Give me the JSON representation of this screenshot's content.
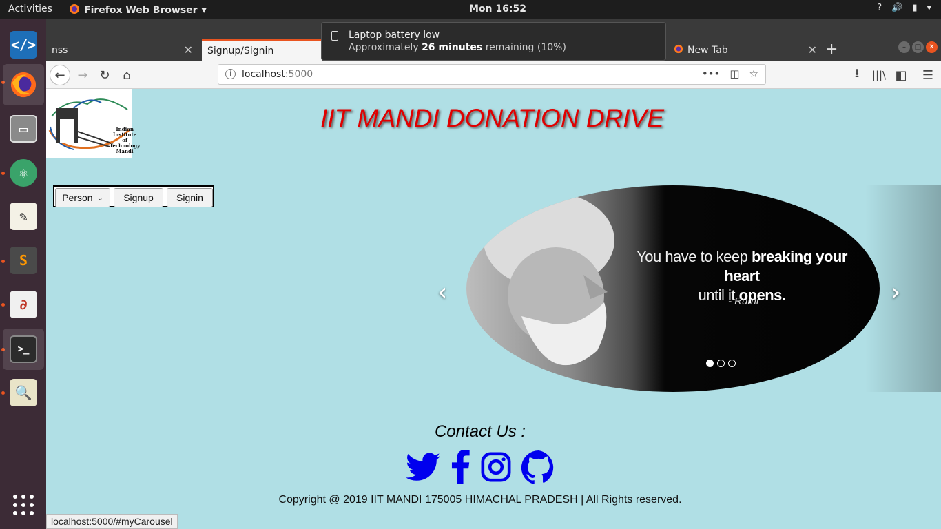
{
  "topbar": {
    "activities": "Activities",
    "app_name": "Firefox Web Browser",
    "clock": "Mon 16:52"
  },
  "browser": {
    "tabs": [
      {
        "title": "nss"
      },
      {
        "title": "Signup/Signin"
      },
      {
        "title": "New Tab"
      }
    ],
    "url_host": "localhost",
    "url_port": ":5000",
    "status_url": "localhost:5000/#myCarousel"
  },
  "notification": {
    "title": "Laptop battery low",
    "body_prefix": "Approximately",
    "body_bold": "26 minutes",
    "body_suffix": "remaining (10%)"
  },
  "page": {
    "logo_text_1": "Indian",
    "logo_text_2": "Institute of",
    "logo_text_3": "Technology",
    "logo_text_4": "Mandi",
    "title": "IIT MANDI DONATION DRIVE",
    "auth": {
      "select_value": "Person",
      "signup_label": "Signup",
      "signin_label": "Signin"
    },
    "carousel": {
      "quote_1": "You have to keep",
      "quote_bold": "breaking your heart",
      "quote_2": "until it",
      "quote_bold_2": "opens.",
      "author": "- Rumi",
      "slide_count": 3,
      "active_index": 0
    },
    "contact_title": "Contact Us :",
    "copyright": "Copyright @ 2019 IIT MANDI 175005 HIMACHAL PRADESH | All Rights reserved.",
    "socials": [
      "twitter-icon",
      "facebook-icon",
      "instagram-icon",
      "github-icon"
    ],
    "social_color": "#0000ee"
  }
}
